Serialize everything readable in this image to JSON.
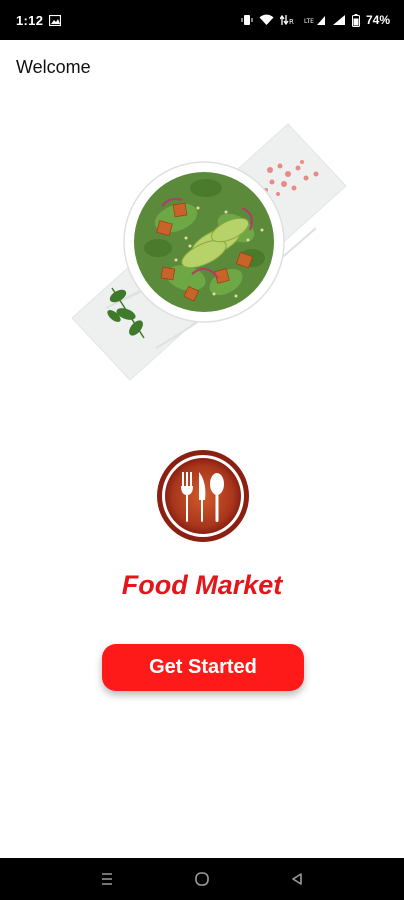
{
  "status_bar": {
    "time": "1:12",
    "battery": "74%",
    "icons": [
      "gallery-notification-icon",
      "vibrate-icon",
      "wifi-icon",
      "volte-icon",
      "signal-icon",
      "signal-icon-2",
      "battery-icon"
    ]
  },
  "header": {
    "title": "Welcome"
  },
  "hero": {
    "image": "salad-bowl-image"
  },
  "logo": {
    "icon": "fork-knife-spoon-icon"
  },
  "brand": {
    "name": "Food Market"
  },
  "cta": {
    "label": "Get Started"
  },
  "nav_bar": {
    "icons": [
      "recents-icon",
      "home-icon",
      "back-icon"
    ]
  },
  "colors": {
    "brand_red": "#e3161c",
    "button_red": "#ff1a1a",
    "logo_dark": "#8a1f12",
    "logo_light": "#d35a2a"
  }
}
